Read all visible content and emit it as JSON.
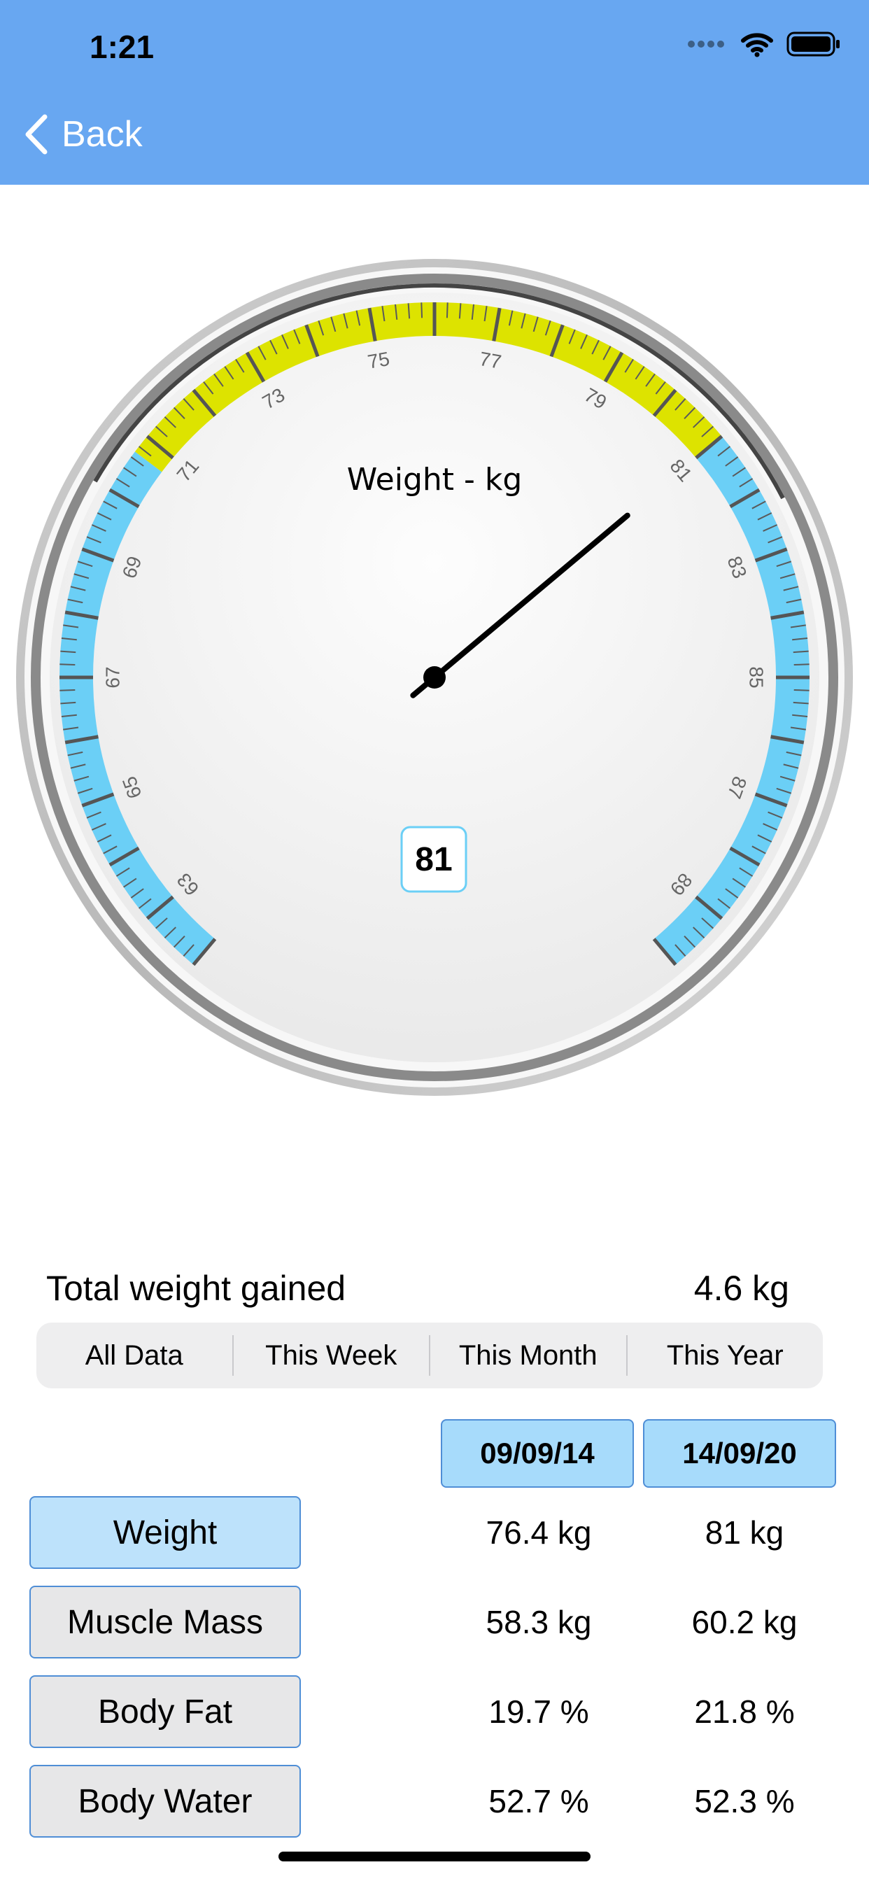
{
  "status": {
    "time": "1:21"
  },
  "nav": {
    "back_label": "Back"
  },
  "gauge": {
    "title": "Weight - kg",
    "value": 81,
    "value_label": "81",
    "min": 62,
    "max": 90,
    "ticks": [
      "63",
      "65",
      "67",
      "69",
      "71",
      "73",
      "75",
      "77",
      "79",
      "81",
      "83",
      "85",
      "87",
      "89"
    ],
    "highlight_range": [
      70.7,
      81
    ],
    "colors": {
      "range": "#6bcff6",
      "highlight": "#dde300",
      "needle": "#000000"
    }
  },
  "summary": {
    "label": "Total weight gained",
    "value": "4.6 kg"
  },
  "periods": [
    "All Data",
    "This Week",
    "This Month",
    "This Year"
  ],
  "table": {
    "dates": [
      "09/09/14",
      "14/09/20"
    ],
    "rows": [
      {
        "label": "Weight",
        "v1": "76.4 kg",
        "v2": "81 kg",
        "active": true
      },
      {
        "label": "Muscle Mass",
        "v1": "58.3 kg",
        "v2": "60.2 kg"
      },
      {
        "label": "Body Fat",
        "v1": "19.7 %",
        "v2": "21.8 %"
      },
      {
        "label": "Body Water",
        "v1": "52.7 %",
        "v2": "52.3 %"
      }
    ]
  },
  "icons": [
    "signal-icon",
    "wifi-icon",
    "battery-icon",
    "chevron-left-icon"
  ],
  "colors": {
    "header": "#68a7f1",
    "accent_border": "#4f8ed6",
    "date_fill": "#a7dbfb"
  }
}
